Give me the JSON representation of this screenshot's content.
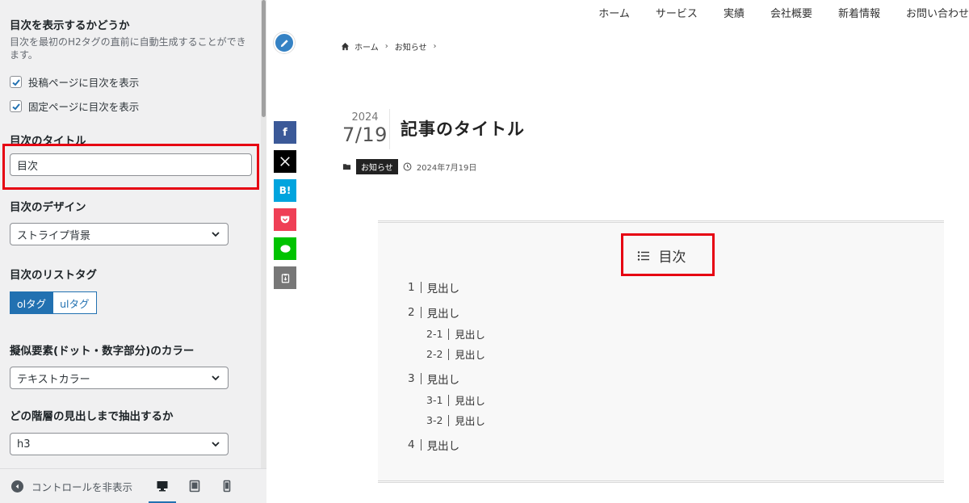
{
  "panel": {
    "toc_display": {
      "title": "目次を表示するかどうか",
      "description": "目次を最初のH2タグの直前に自動生成することができます。",
      "options": [
        {
          "label": "投稿ページに目次を表示",
          "checked": true
        },
        {
          "label": "固定ページに目次を表示",
          "checked": true
        }
      ]
    },
    "toc_title": {
      "title": "目次のタイトル",
      "value": "目次"
    },
    "toc_design": {
      "title": "目次のデザイン",
      "selected": "ストライプ背景"
    },
    "toc_list_tag": {
      "title": "目次のリストタグ",
      "options": [
        "olタグ",
        "ulタグ"
      ],
      "active": "olタグ"
    },
    "toc_pseudo_color": {
      "title": "擬似要素(ドット・数字部分)のカラー",
      "selected": "テキストカラー"
    },
    "toc_depth": {
      "title": "どの階層の見出しまで抽出するか",
      "selected": "h3"
    },
    "footer": {
      "hide_controls": "コントロールを非表示",
      "devices": [
        "desktop-icon",
        "tablet-icon",
        "mobile-icon"
      ],
      "active_device": "desktop-icon"
    },
    "accent_color": "#2271b1",
    "highlight_color": "#e60012"
  },
  "preview": {
    "nav": [
      "ホーム",
      "サービス",
      "実績",
      "会社概要",
      "新着情報",
      "お問い合わせ"
    ],
    "breadcrumb": [
      "ホーム",
      "お知らせ"
    ],
    "share_buttons": [
      {
        "name": "facebook",
        "label": "f",
        "color": "#3b5998"
      },
      {
        "name": "x",
        "label": "𝕏",
        "color": "#000000"
      },
      {
        "name": "hatena",
        "label": "B!",
        "color": "#00a4de"
      },
      {
        "name": "pocket",
        "label": "",
        "color": "#ef3f56"
      },
      {
        "name": "line",
        "label": "",
        "color": "#00c300"
      },
      {
        "name": "copy",
        "label": "",
        "color": "#777777"
      }
    ],
    "post": {
      "year": "2024",
      "month_day": "7/19",
      "title": "記事のタイトル",
      "category": "お知らせ",
      "date": "2024年7月19日"
    },
    "toc": {
      "title": "目次",
      "items": [
        {
          "num": "1",
          "text": "見出し",
          "children": []
        },
        {
          "num": "2",
          "text": "見出し",
          "children": [
            {
              "num": "2-1",
              "text": "見出し"
            },
            {
              "num": "2-2",
              "text": "見出し"
            }
          ]
        },
        {
          "num": "3",
          "text": "見出し",
          "children": [
            {
              "num": "3-1",
              "text": "見出し"
            },
            {
              "num": "3-2",
              "text": "見出し"
            }
          ]
        },
        {
          "num": "4",
          "text": "見出し",
          "children": []
        }
      ]
    }
  }
}
